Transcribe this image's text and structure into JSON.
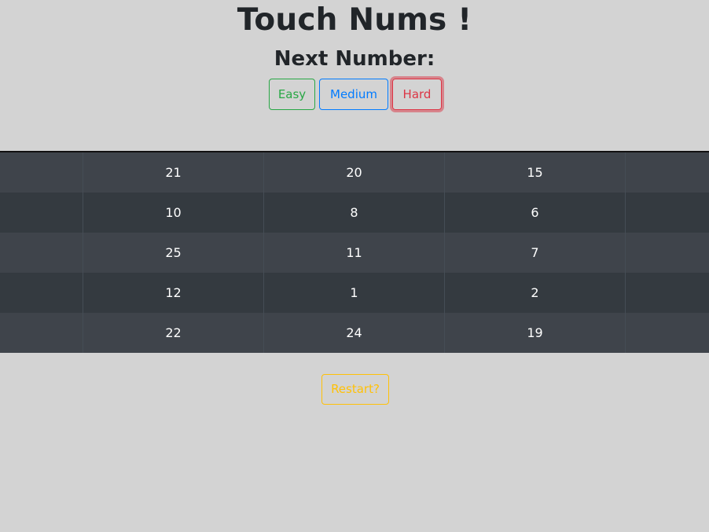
{
  "header": {
    "title": "Touch Nums !",
    "next_number_label": "Next Number:"
  },
  "levels": {
    "easy": "Easy",
    "medium": "Medium",
    "hard": "Hard",
    "selected": "Hard"
  },
  "board": {
    "rows": [
      [
        "",
        "21",
        "20",
        "15",
        ""
      ],
      [
        "",
        "10",
        "8",
        "6",
        ""
      ],
      [
        "",
        "25",
        "11",
        "7",
        ""
      ],
      [
        "",
        "12",
        "1",
        "2",
        ""
      ],
      [
        "",
        "22",
        "24",
        "19",
        ""
      ]
    ]
  },
  "restart_label": "Restart?",
  "colors": {
    "background": "#d3d3d3",
    "easy": "#28a745",
    "medium": "#007bff",
    "hard": "#dc3545",
    "restart": "#ffc107",
    "row_light": "#3f444b",
    "row_dark": "#343a40"
  }
}
